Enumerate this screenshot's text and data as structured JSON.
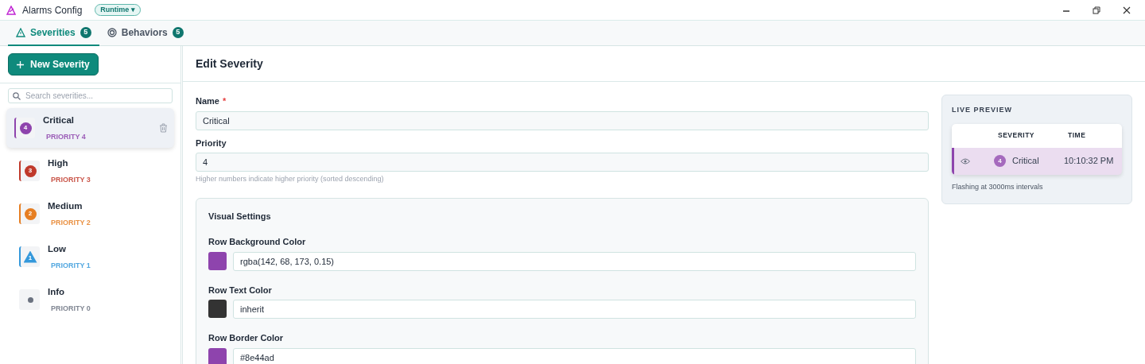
{
  "window": {
    "title": "Alarms Config",
    "mode_badge": "Runtime ▾"
  },
  "tabs": [
    {
      "label": "Severities",
      "count": "5",
      "selected": true
    },
    {
      "label": "Behaviors",
      "count": "5",
      "selected": false
    }
  ],
  "sidebar": {
    "new_button": "New Severity",
    "search": {
      "placeholder": "Search severities..."
    },
    "items": [
      {
        "name": "Critical",
        "priority": "PRIORITY 4",
        "badge": "4",
        "kind": "circle",
        "color": "#8e44ad",
        "selected": true
      },
      {
        "name": "High",
        "priority": "PRIORITY 3",
        "badge": "3",
        "kind": "circle",
        "color": "#c0392b",
        "selected": false
      },
      {
        "name": "Medium",
        "priority": "PRIORITY 2",
        "badge": "2",
        "kind": "circle",
        "color": "#e67e22",
        "selected": false
      },
      {
        "name": "Low",
        "priority": "PRIORITY 1",
        "badge": "1",
        "kind": "triangle",
        "color": "#3498db",
        "selected": false
      },
      {
        "name": "Info",
        "priority": "PRIORITY 0",
        "kind": "dot",
        "color": "#6b7280",
        "selected": false
      }
    ]
  },
  "editor": {
    "title": "Edit Severity",
    "fields": [
      {
        "label": "Name",
        "required_mark": "*",
        "value": "Critical"
      },
      {
        "label": "Priority",
        "value": "4",
        "hint": "Higher numbers indicate higher priority (sorted descending)"
      }
    ],
    "visual_settings": {
      "title": "Visual Settings",
      "colors": [
        {
          "label": "Row Background Color",
          "color": "#8e44ad",
          "value": "rgba(142, 68, 173, 0.15)"
        },
        {
          "label": "Row Text Color",
          "color": "#333333",
          "value": "inherit"
        },
        {
          "label": "Row Border Color",
          "color": "#8e44ad",
          "value": "#8e44ad"
        }
      ]
    }
  },
  "preview": {
    "title": "LIVE PREVIEW",
    "columns": [
      "SEVERITY",
      "TIME"
    ],
    "row": {
      "badge": "4",
      "severity": "Critical",
      "time": "10:10:32 PM",
      "color": "#8e44ad"
    },
    "note": "Flashing at 3000ms intervals"
  }
}
